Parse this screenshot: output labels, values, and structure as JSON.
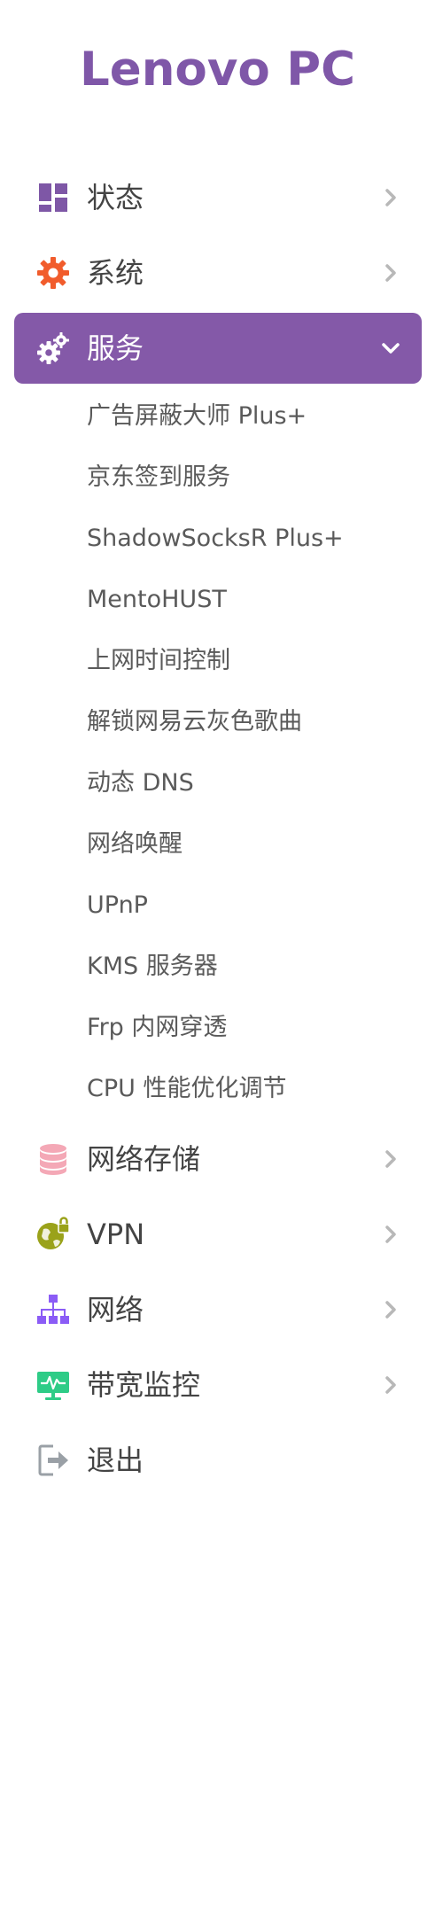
{
  "brand": "Lenovo PC",
  "menu": {
    "status": {
      "label": "状态",
      "icon": "dashboard-icon",
      "color": "#7e57a6"
    },
    "system": {
      "label": "系统",
      "icon": "gear-icon",
      "color": "#f15c2c"
    },
    "services": {
      "label": "服务",
      "icon": "gears-icon",
      "color": "#ffffff",
      "active_bg": "#8459a8"
    },
    "services_sub": [
      "广告屏蔽大师 Plus+",
      "京东签到服务",
      "ShadowSocksR Plus+",
      "MentoHUST",
      "上网时间控制",
      "解锁网易云灰色歌曲",
      "动态 DNS",
      "网络唤醒",
      "UPnP",
      "KMS 服务器",
      "Frp 内网穿透",
      "CPU 性能优化调节"
    ],
    "nas": {
      "label": "网络存储",
      "icon": "database-icon",
      "color": "#f4a8b6"
    },
    "vpn": {
      "label": "VPN",
      "icon": "globe-lock-icon",
      "color": "#9aa21a"
    },
    "network": {
      "label": "网络",
      "icon": "sitemap-icon",
      "color": "#8b5cf6"
    },
    "bandwidth": {
      "label": "带宽监控",
      "icon": "monitor-pulse-icon",
      "color": "#2ecc87"
    },
    "logout": {
      "label": "退出",
      "icon": "sign-out-icon",
      "color": "#9aa0a6"
    }
  }
}
